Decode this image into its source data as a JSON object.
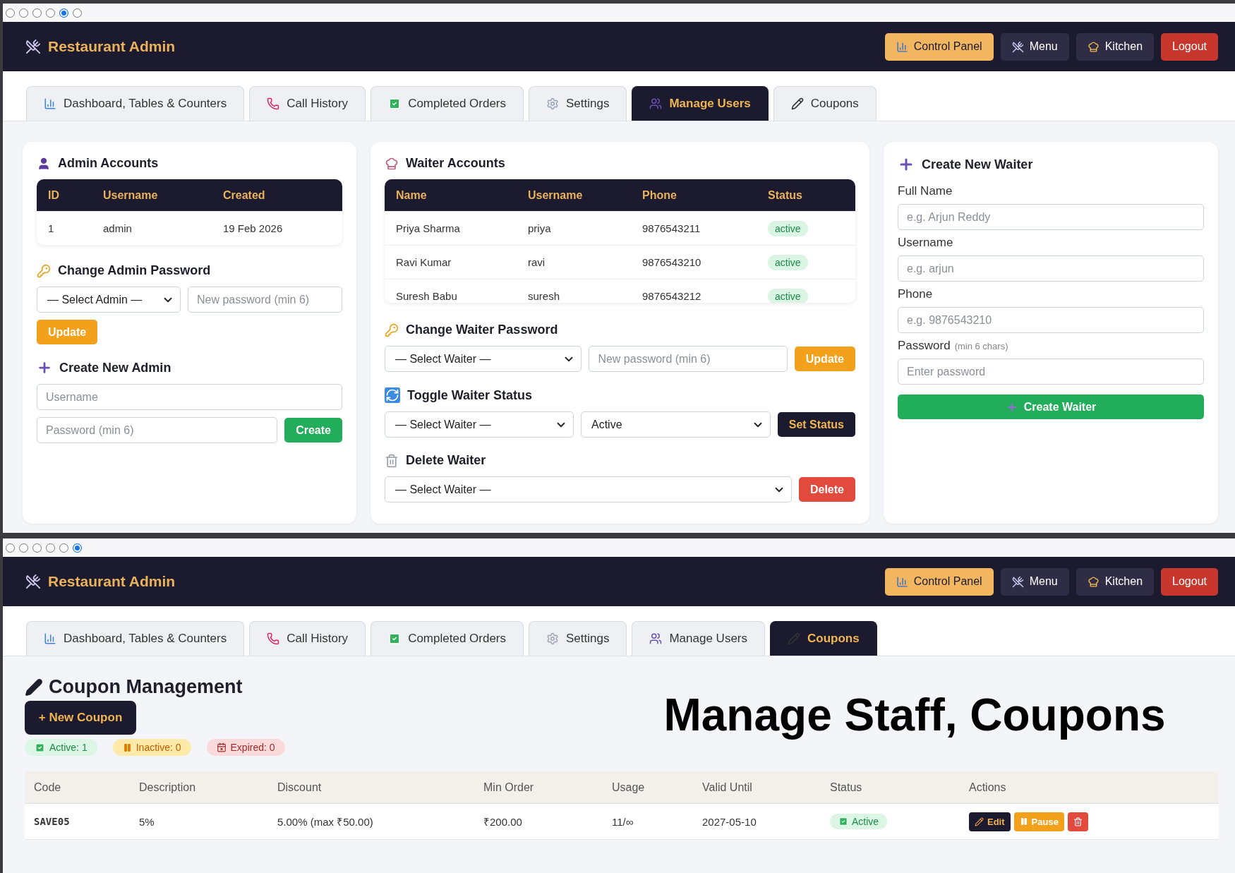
{
  "users_screen": {
    "browser_dots": [
      {
        "selected": false
      },
      {
        "selected": false
      },
      {
        "selected": false
      },
      {
        "selected": false
      },
      {
        "selected": true
      },
      {
        "selected": false
      }
    ],
    "header": {
      "title": "Restaurant Admin",
      "buttons": [
        {
          "label": "Control Panel",
          "kind": "panel"
        },
        {
          "label": "Menu",
          "kind": "menu"
        },
        {
          "label": "Kitchen",
          "kind": "kitchen"
        },
        {
          "label": "Logout",
          "kind": "logout"
        }
      ]
    },
    "tabs": [
      {
        "label": "Dashboard, Tables & Counters",
        "selected": false
      },
      {
        "label": "Call History",
        "selected": false
      },
      {
        "label": "Completed Orders",
        "selected": false
      },
      {
        "label": "Settings",
        "selected": false
      },
      {
        "label": "Manage Users",
        "selected": true
      },
      {
        "label": "Coupons",
        "selected": false
      }
    ],
    "admin_accounts": {
      "title": "Admin Accounts",
      "columns": [
        "ID",
        "Username",
        "Created"
      ],
      "rows": [
        [
          "1",
          "admin",
          "19 Feb 2026"
        ]
      ]
    },
    "change_admin_password": {
      "title": "Change Admin Password",
      "select": "— Select Admin —",
      "placeholder": "New password (min 6)",
      "button": "Update"
    },
    "create_admin": {
      "title": "Create New Admin",
      "username_placeholder": "Username",
      "password_placeholder": "Password (min 6)",
      "button": "Create"
    },
    "waiter_accounts": {
      "title": "Waiter Accounts",
      "columns": [
        "Name",
        "Username",
        "Phone",
        "Status"
      ],
      "rows": [
        {
          "name": "Priya Sharma",
          "username": "priya",
          "phone": "9876543211",
          "status": "active"
        },
        {
          "name": "Ravi Kumar",
          "username": "ravi",
          "phone": "9876543210",
          "status": "active"
        },
        {
          "name": "Suresh Babu",
          "username": "suresh",
          "phone": "9876543212",
          "status": "active"
        }
      ]
    },
    "change_waiter_password": {
      "title": "Change Waiter Password",
      "select": "— Select Waiter —",
      "placeholder": "New password (min 6)",
      "button": "Update"
    },
    "toggle_waiter_status": {
      "title": "Toggle Waiter Status",
      "select": "— Select Waiter —",
      "status": "Active",
      "button": "Set Status"
    },
    "delete_waiter": {
      "title": "Delete Waiter",
      "select": "— Select Waiter —",
      "button": "Delete"
    },
    "create_waiter": {
      "title": "Create New Waiter",
      "fields": [
        {
          "label": "Full Name",
          "placeholder": "e.g. Arjun Reddy"
        },
        {
          "label": "Username",
          "placeholder": "e.g. arjun"
        },
        {
          "label": "Phone",
          "placeholder": "e.g. 9876543210"
        },
        {
          "label": "Password",
          "hint": "(min 6 chars)",
          "placeholder": "Enter password"
        }
      ],
      "button": "Create Waiter"
    }
  },
  "coupons_screen": {
    "browser_dots": [
      {
        "selected": false
      },
      {
        "selected": false
      },
      {
        "selected": false
      },
      {
        "selected": false
      },
      {
        "selected": false
      },
      {
        "selected": true
      }
    ],
    "header": {
      "title": "Restaurant Admin",
      "buttons": [
        {
          "label": "Control Panel",
          "kind": "panel"
        },
        {
          "label": "Menu",
          "kind": "menu"
        },
        {
          "label": "Kitchen",
          "kind": "kitchen"
        },
        {
          "label": "Logout",
          "kind": "logout"
        }
      ]
    },
    "tabs": [
      {
        "label": "Dashboard, Tables & Counters",
        "selected": false
      },
      {
        "label": "Call History",
        "selected": false
      },
      {
        "label": "Completed Orders",
        "selected": false
      },
      {
        "label": "Settings",
        "selected": false
      },
      {
        "label": "Manage Users",
        "selected": false
      },
      {
        "label": "Coupons",
        "selected": true
      }
    ],
    "title": "Coupon Management",
    "new_button": "+ New Coupon",
    "counts": [
      {
        "kind": "active",
        "label": "Active: 1"
      },
      {
        "kind": "inactive",
        "label": "Inactive: 0"
      },
      {
        "kind": "expired",
        "label": "Expired: 0"
      }
    ],
    "table": {
      "columns": [
        "Code",
        "Description",
        "Discount",
        "Min Order",
        "Usage",
        "Valid Until",
        "Status",
        "Actions"
      ],
      "rows": [
        {
          "code": "SAVE05",
          "description": "5%",
          "discount": "5.00% (max ₹50.00)",
          "min_order": "₹200.00",
          "usage": "11/∞",
          "valid_until": "2027-05-10",
          "status": "Active",
          "actions": [
            {
              "kind": "edit",
              "label": "Edit"
            },
            {
              "kind": "pause",
              "label": "Pause"
            },
            {
              "kind": "delete"
            }
          ]
        }
      ]
    }
  },
  "caption": "Manage Staff, Coupons"
}
